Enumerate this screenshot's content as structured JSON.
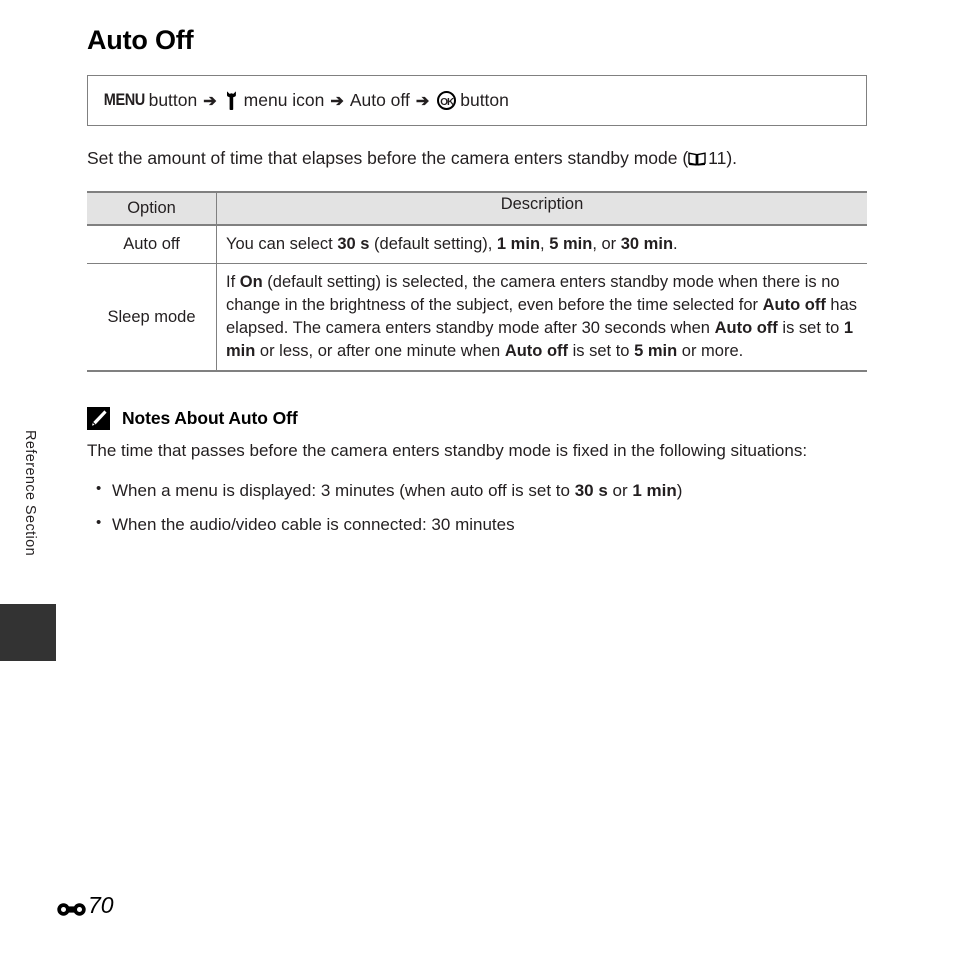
{
  "sidebar": {
    "section_label": "Reference Section"
  },
  "page": {
    "title": "Auto Off",
    "folio_symbol": "E-symbol",
    "folio_number": "70"
  },
  "nav_path": {
    "menu_button_label": "MENU",
    "button_word": "button",
    "arrow": "➔",
    "setup_icon_name": "wrench-icon",
    "menu_icon_label": "menu icon",
    "item_label": "Auto off",
    "ok_icon_label": "OK",
    "ok_button_word": "button"
  },
  "intro": {
    "text_before": "Set the amount of time that elapses before the camera enters standby mode (",
    "ref_icon_name": "book-icon",
    "ref_page": "11",
    "text_after": ")."
  },
  "table": {
    "headers": [
      "Option",
      "Description"
    ],
    "rows": [
      {
        "option": "Auto off",
        "description_parts": [
          {
            "text": "You can select ",
            "bold": false
          },
          {
            "text": "30 s",
            "bold": true
          },
          {
            "text": " (default setting), ",
            "bold": false
          },
          {
            "text": "1 min",
            "bold": true
          },
          {
            "text": ", ",
            "bold": false
          },
          {
            "text": "5 min",
            "bold": true
          },
          {
            "text": ", or ",
            "bold": false
          },
          {
            "text": "30 min",
            "bold": true
          },
          {
            "text": ".",
            "bold": false
          }
        ]
      },
      {
        "option": "Sleep mode",
        "description_parts": [
          {
            "text": "If ",
            "bold": false
          },
          {
            "text": "On",
            "bold": true
          },
          {
            "text": " (default setting) is selected, the camera enters standby mode when there is no change in the brightness of the subject, even before the time selected for ",
            "bold": false
          },
          {
            "text": "Auto off",
            "bold": true
          },
          {
            "text": " has elapsed. The camera enters standby mode after 30 seconds when ",
            "bold": false
          },
          {
            "text": "Auto off",
            "bold": true
          },
          {
            "text": " is set to ",
            "bold": false
          },
          {
            "text": "1 min",
            "bold": true
          },
          {
            "text": " or less, or after one minute when ",
            "bold": false
          },
          {
            "text": "Auto off",
            "bold": true
          },
          {
            "text": " is set to ",
            "bold": false
          },
          {
            "text": "5 min",
            "bold": true
          },
          {
            "text": " or more.",
            "bold": false
          }
        ]
      }
    ]
  },
  "note": {
    "icon_name": "pencil-icon",
    "title": "Notes About Auto Off",
    "intro": "The time that passes before the camera enters standby mode is fixed in the following situations:",
    "bullets": [
      [
        {
          "text": "When a menu is displayed: 3 minutes (when auto off is set to ",
          "bold": false
        },
        {
          "text": "30 s",
          "bold": true
        },
        {
          "text": " or ",
          "bold": false
        },
        {
          "text": "1 min",
          "bold": true
        },
        {
          "text": ")",
          "bold": false
        }
      ],
      [
        {
          "text": "When the audio/video cable is connected: 30 minutes",
          "bold": false
        }
      ]
    ]
  },
  "colors": {
    "text": "#231f20",
    "rule": "#808080",
    "header_fill": "#e3e3e3",
    "tab_fill": "#333333"
  }
}
